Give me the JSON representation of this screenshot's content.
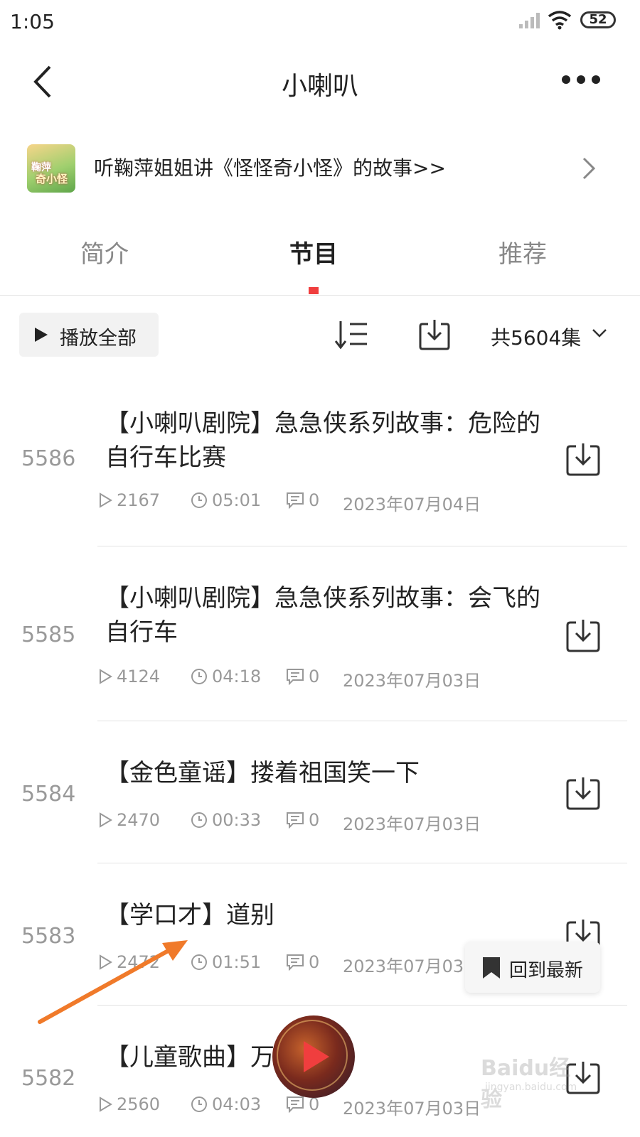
{
  "status_bar": {
    "time": "1:05",
    "battery": "52"
  },
  "header": {
    "title": "小喇叭"
  },
  "banner": {
    "thumb_text_1": "鞠萍",
    "thumb_text_2": "奇小怪",
    "text": "听鞠萍姐姐讲《怪怪奇小怪》的故事>>"
  },
  "tabs": [
    {
      "label": "简介",
      "active": false
    },
    {
      "label": "节目",
      "active": true
    },
    {
      "label": "推荐",
      "active": false
    }
  ],
  "toolbar": {
    "play_all": "播放全部",
    "count": "共5604集"
  },
  "episodes": [
    {
      "num": "5586",
      "title": "【小喇叭剧院】急急侠系列故事：危险的自行车比赛",
      "plays": "2167",
      "duration": "05:01",
      "comments": "0",
      "date": "2023年07月04日"
    },
    {
      "num": "5585",
      "title": "【小喇叭剧院】急急侠系列故事：会飞的自行车",
      "plays": "4124",
      "duration": "04:18",
      "comments": "0",
      "date": "2023年07月03日"
    },
    {
      "num": "5584",
      "title": "【金色童谣】搂着祖国笑一下",
      "plays": "2470",
      "duration": "00:33",
      "comments": "0",
      "date": "2023年07月03日"
    },
    {
      "num": "5583",
      "title": "【学口才】道别",
      "plays": "2472",
      "duration": "01:51",
      "comments": "0",
      "date": "2023年07月03日"
    },
    {
      "num": "5582",
      "title": "【儿童歌曲】万    山",
      "plays": "2560",
      "duration": "04:03",
      "comments": "0",
      "date": "2023年07月03日"
    }
  ],
  "back_to_latest": "回到最新",
  "watermark": {
    "brand": "Baidu经验",
    "url": "jingyan.baidu.com"
  },
  "colors": {
    "accent": "#f03e3e",
    "arrow": "#f07a2a",
    "muted": "#999999"
  }
}
